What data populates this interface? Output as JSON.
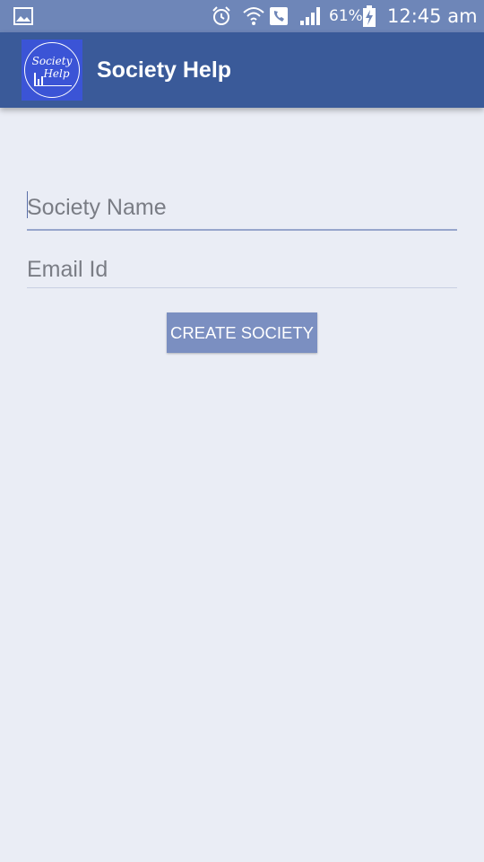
{
  "status_bar": {
    "battery_percent": "61%",
    "time": "12:45 am",
    "icons": [
      "gallery-icon",
      "alarm-icon",
      "wifi-icon",
      "call-icon",
      "signal-icon",
      "battery-charging-icon"
    ]
  },
  "app_bar": {
    "title": "Society Help",
    "logo": {
      "line1": "Society",
      "line2": "Help"
    }
  },
  "form": {
    "society_name": {
      "value": "",
      "placeholder": "Society Name"
    },
    "email": {
      "value": "",
      "placeholder": "Email Id"
    },
    "create_button_label": "CREATE SOCIETY"
  },
  "colors": {
    "status_bar": "#6e86b8",
    "app_bar": "#3a5a99",
    "background": "#eaedf5",
    "button": "#7b8fc1",
    "logo_background": "#3b54d6"
  }
}
